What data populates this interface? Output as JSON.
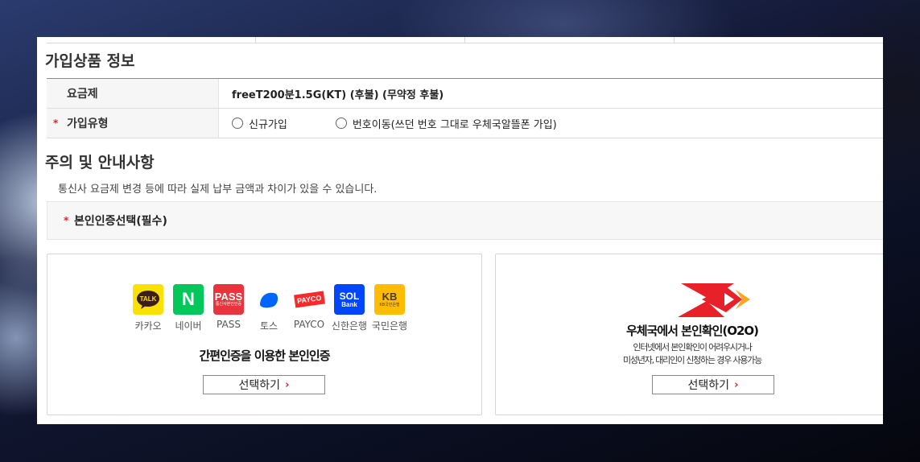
{
  "section_product": {
    "title": "가입상품 정보"
  },
  "plan": {
    "label": "요금제",
    "value": "freeT200분1.5G(KT) (후불) (무약정 후불)"
  },
  "join_type": {
    "label": "가입유형",
    "required_mark": "*",
    "options": [
      "신규가입",
      "번호이동(쓰던 번호 그대로 우체국알뜰폰 가입)"
    ]
  },
  "section_notice": {
    "title": "주의 및 안내사항",
    "text": "통신사 요금제 변경 등에 따라 실제 납부 금액과 차이가 있을 수 있습니다."
  },
  "auth_select": {
    "required_mark": "*",
    "label": "본인인증선택(필수)"
  },
  "simple_auth": {
    "providers": [
      {
        "icon": "kakao-talk-icon",
        "logo_text": "TALK",
        "label": "카카오",
        "color": "#fae100"
      },
      {
        "icon": "naver-icon",
        "logo_text": "N",
        "label": "네이버",
        "color": "#03c75a"
      },
      {
        "icon": "pass-icon",
        "logo_text": "PASS",
        "logo_sub": "통신사본인인증",
        "label": "PASS",
        "color": "#e8343c"
      },
      {
        "icon": "toss-icon",
        "label": "토스",
        "color": "#0064ff"
      },
      {
        "icon": "payco-icon",
        "logo_text": "PAYCO",
        "label": "PAYCO",
        "color": "#fa2828"
      },
      {
        "icon": "shinhan-sol-icon",
        "logo_text": "SOL",
        "logo_sub": "Bank",
        "label": "신한은행",
        "color": "#0046ff"
      },
      {
        "icon": "kb-bank-icon",
        "logo_text": "KB",
        "logo_sub": "KB국민은행",
        "label": "국민은행",
        "color": "#ffbc00"
      }
    ],
    "title": "간편인증을 이용한 본인인증",
    "button": "선택하기",
    "button_arrow": "›"
  },
  "o2o_auth": {
    "title": "우체국에서 본인확인(O2O)",
    "desc_line1": "인터넷에서 본인확인이 어려우시거나",
    "desc_line2": "미성년자, 대리인이 신청하는 경우 사용가능",
    "button": "선택하기",
    "button_arrow": "›",
    "logo_color": "#e8202a"
  }
}
